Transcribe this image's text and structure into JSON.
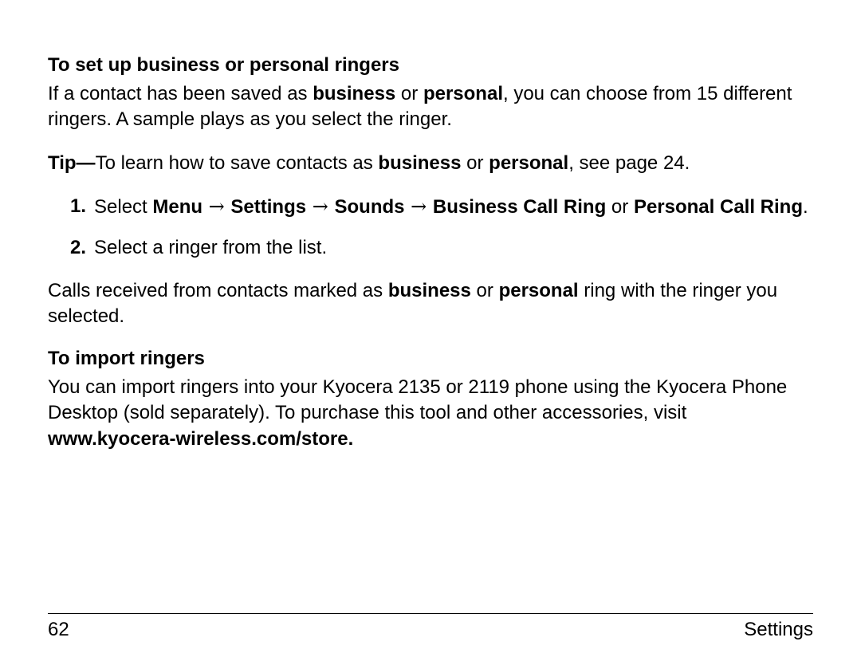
{
  "section1": {
    "heading": "To set up business or personal ringers",
    "intro_1a": "If a contact has been saved as ",
    "intro_1_b1": "business",
    "intro_1b": " or ",
    "intro_1_b2": "personal",
    "intro_1c": ", you can choose from 15 different ringers. A sample plays as you select the ringer.",
    "tip_label": "Tip—",
    "tip_a": "To learn how to save contacts as ",
    "tip_b1": "business",
    "tip_b": " or ",
    "tip_b2": "personal",
    "tip_c": ", see page 24.",
    "step1": {
      "num": "1.",
      "a": "Select ",
      "menu": "Menu",
      "arrow": " → ",
      "settings": "Settings",
      "sounds": "Sounds",
      "bcr": "Business Call Ring",
      "or": " or ",
      "pcr": "Personal Call Ring",
      "dot": "."
    },
    "step2": {
      "num": "2.",
      "text": "Select a ringer from the list."
    },
    "outro_a": "Calls received from contacts marked as ",
    "outro_b1": "business",
    "outro_b": " or ",
    "outro_b2": "personal",
    "outro_c": " ring with the ringer you selected."
  },
  "section2": {
    "heading": "To import ringers",
    "body_a": "You can import ringers into your Kyocera 2135 or 2119 phone using the Kyocera Phone Desktop (sold separately). To purchase this tool and other accessories, visit ",
    "url": "www.kyocera-wireless.com/store."
  },
  "footer": {
    "page": "62",
    "section": "Settings"
  }
}
